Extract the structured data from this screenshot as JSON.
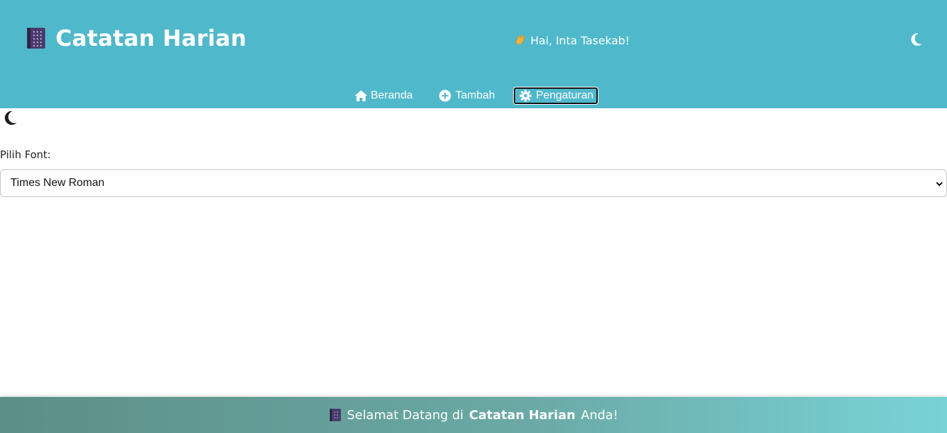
{
  "header": {
    "title": "Catatan Harian",
    "book_icon": "notebook-icon",
    "greeting": "Hai, Inta Tasekab!",
    "greeting_icon": "waving-hand-icon",
    "theme_icon": "moon-icon",
    "background_color": "#4fb8cb"
  },
  "nav": {
    "items": [
      {
        "label": "Beranda",
        "icon": "home-icon"
      },
      {
        "label": "Tambah",
        "icon": "plus-circle-icon"
      },
      {
        "label": "Pengaturan",
        "icon": "gear-icon",
        "active": true
      }
    ]
  },
  "settings": {
    "theme_toggle_icon": "moon-icon",
    "font_label": "Pilih Font:",
    "font_selected": "Times New Roman"
  },
  "footer": {
    "prefix": "Selamat Datang di",
    "app_name": "Catatan Harian",
    "suffix": "Anda!",
    "book_icon": "notebook-icon"
  }
}
